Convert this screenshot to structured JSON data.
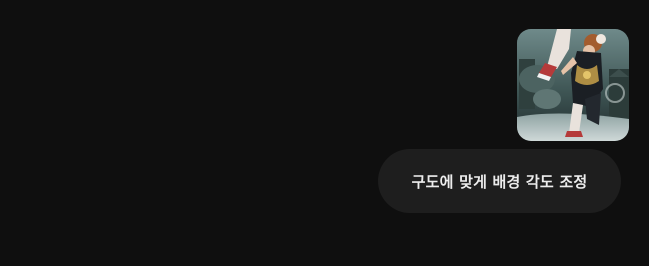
{
  "colors": {
    "background": "#0f0f0f",
    "bubble": "#1e1e1e",
    "text": "#ececec"
  },
  "attachment": {
    "kind": "image",
    "icon": "image-thumbnail"
  },
  "message": {
    "text": "구도에 맞게 배경 각도 조정"
  }
}
